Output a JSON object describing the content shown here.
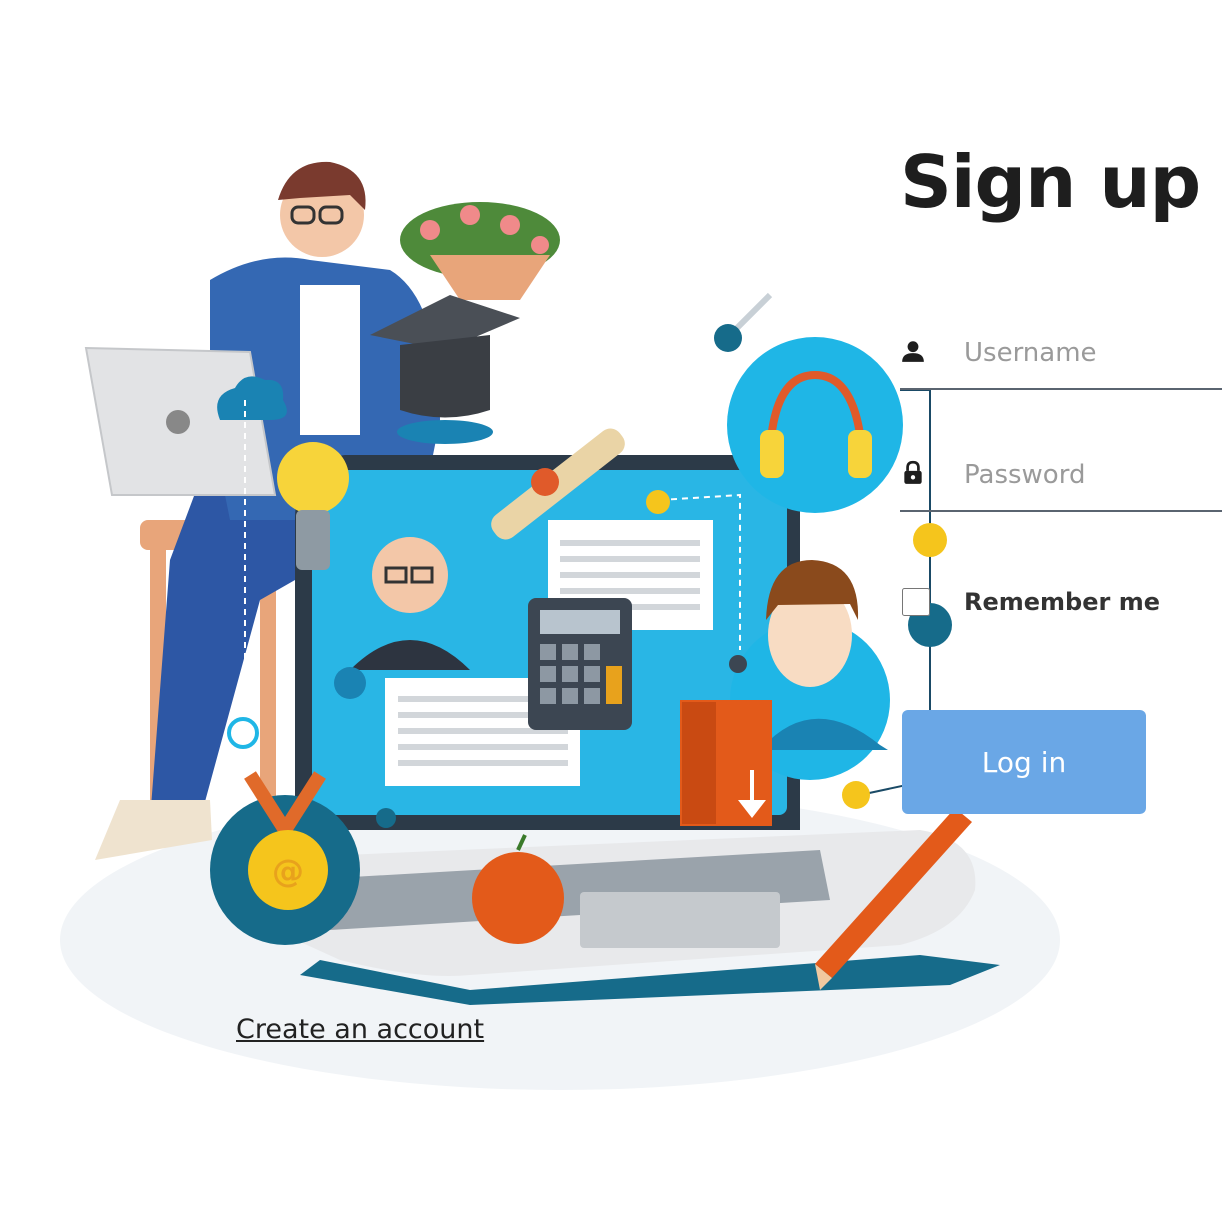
{
  "form": {
    "title": "Sign up",
    "username_placeholder": "Username",
    "password_placeholder": "Password",
    "remember_label": "Remember me",
    "login_label": "Log in",
    "create_account_label": "Create an account"
  },
  "icons": {
    "username": "person-icon",
    "password": "lock-icon"
  },
  "colors": {
    "login_button": "#6aa7e6",
    "accent_cyan": "#1fb6e6",
    "accent_dark_teal": "#0e6a8c",
    "title_text": "#1e1e1e"
  }
}
